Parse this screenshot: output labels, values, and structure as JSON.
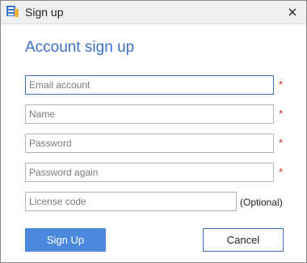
{
  "window": {
    "title": "Sign up",
    "app_icon": "app-logo-icon",
    "close_icon": "close-icon"
  },
  "form": {
    "heading": "Account sign up",
    "fields": [
      {
        "placeholder": "Email account",
        "value": "",
        "required": true,
        "focused": true
      },
      {
        "placeholder": "Name",
        "value": "",
        "required": true,
        "focused": false
      },
      {
        "placeholder": "Password",
        "value": "",
        "required": true,
        "focused": false
      },
      {
        "placeholder": "Password again",
        "value": "",
        "required": true,
        "focused": false
      },
      {
        "placeholder": "License code",
        "value": "",
        "required": false,
        "focused": false
      }
    ],
    "required_marker": "*",
    "optional_label": "(Optional)"
  },
  "buttons": {
    "signup_label": "Sign Up",
    "cancel_label": "Cancel"
  },
  "colors": {
    "heading": "#3e6fc4",
    "primary_button": "#4a89dc",
    "required_marker": "#d42020",
    "focus_border": "#3c6fb4"
  }
}
